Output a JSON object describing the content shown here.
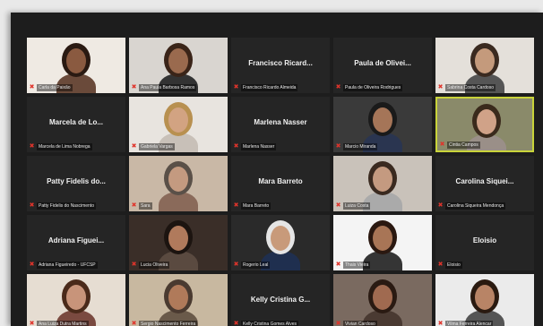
{
  "participants": [
    {
      "title": "",
      "name": "Carla da Paixão",
      "video": true,
      "bg": "#efeae3",
      "skin": "#8a5a40",
      "hair": "#2a1a12",
      "shirt": "#6a4a3a"
    },
    {
      "title": "",
      "name": "Ana Paula Barbosa Ramos",
      "video": true,
      "bg": "#d9d5d0",
      "skin": "#9a6a4e",
      "hair": "#3a2418",
      "shirt": "#333333"
    },
    {
      "title": "Francisco Ricard...",
      "name": "Francisco Ricardo Almeida",
      "video": false
    },
    {
      "title": "Paula de Olivei...",
      "name": "Paula de Oliveira Rodrigues",
      "video": false
    },
    {
      "title": "",
      "name": "Sabrina Costa Cardoso",
      "video": true,
      "bg": "#e4e0da",
      "skin": "#c49a7c",
      "hair": "#3a2a20",
      "shirt": "#555555"
    },
    {
      "title": "Marcela de Lo...",
      "name": "Marcela de Lima Nobrega",
      "video": false
    },
    {
      "title": "",
      "name": "Gabriela Vargas",
      "video": true,
      "bg": "#e8e4df",
      "skin": "#d2a382",
      "hair": "#b89050",
      "shirt": "#c8c0b8"
    },
    {
      "title": "Marlena Nasser",
      "name": "Marlena Nasser",
      "video": false
    },
    {
      "title": "",
      "name": "Marcio Miranda",
      "video": true,
      "bg": "#3a3a3a",
      "skin": "#a57558",
      "hair": "#1a1a1a",
      "shirt": "#2a3550"
    },
    {
      "title": "",
      "name": "Cintia Campos",
      "video": true,
      "bg": "#8a8a6a",
      "skin": "#d0a288",
      "hair": "#3a2a1c",
      "shirt": "#9a8f88"
    },
    {
      "title": "Patty Fidelis do...",
      "name": "Patty Fidelis do Nascimento",
      "video": false
    },
    {
      "title": "",
      "name": "Sara",
      "video": true,
      "bg": "#c9b8a6",
      "skin": "#c49a80",
      "hair": "#5a5048",
      "shirt": "#8a6a5a"
    },
    {
      "title": "Mara Barreto",
      "name": "Mara Barreto",
      "video": false
    },
    {
      "title": "",
      "name": "Luiza Costa",
      "video": true,
      "bg": "#c9c2ba",
      "skin": "#c49a80",
      "hair": "#3a2a20",
      "shirt": "#aaaaaa"
    },
    {
      "title": "Carolina Siquei...",
      "name": "Carolina Siqueira Mendonça",
      "video": false
    },
    {
      "title": "Adriana Figuei...",
      "name": "Adriana Figueiredo - UFCSP",
      "video": false
    },
    {
      "title": "",
      "name": "Lucia Oliveira",
      "video": true,
      "bg": "#3a2e28",
      "skin": "#b07a5c",
      "hair": "#1c1410",
      "shirt": "#5a4a40"
    },
    {
      "title": "",
      "name": "Rogerio Leal",
      "video": true,
      "bg": "#2a2a2a",
      "skin": "#c89a7a",
      "hair": "#e5e5e5",
      "shirt": "#1f2f4f"
    },
    {
      "title": "",
      "name": "Thais Vieira",
      "video": true,
      "bg": "#f4f4f4",
      "skin": "#a87556",
      "hair": "#2a1810",
      "shirt": "#353535"
    },
    {
      "title": "Eloisio",
      "name": "Eloisio",
      "video": false
    },
    {
      "title": "",
      "name": "Ana Luiza Dutra Martins",
      "video": true,
      "bg": "#e6ddd2",
      "skin": "#c8947a",
      "hair": "#4a2a1a",
      "shirt": "#7a4a40"
    },
    {
      "title": "",
      "name": "Sergio Nascimento Ferreira",
      "video": true,
      "bg": "#c8b8a0",
      "skin": "#b07a5a",
      "hair": "#4a3a30",
      "shirt": "#6a5a4a"
    },
    {
      "title": "Kelly Cristina G...",
      "name": "Kelly Cristina Gomes Alves",
      "video": false
    },
    {
      "title": "",
      "name": "Vivian Cardoso",
      "video": true,
      "bg": "#7a6a60",
      "skin": "#a06a50",
      "hair": "#2a1a12",
      "shirt": "#4a3a32"
    },
    {
      "title": "",
      "name": "Vilma Ferreira Alencar",
      "video": true,
      "bg": "#ebebeb",
      "skin": "#b88466",
      "hair": "#2a1a10",
      "shirt": "#555555"
    }
  ],
  "active_index": 9,
  "colors": {
    "mic_muted": "#e0342b",
    "active_border": "#c9d43a"
  }
}
